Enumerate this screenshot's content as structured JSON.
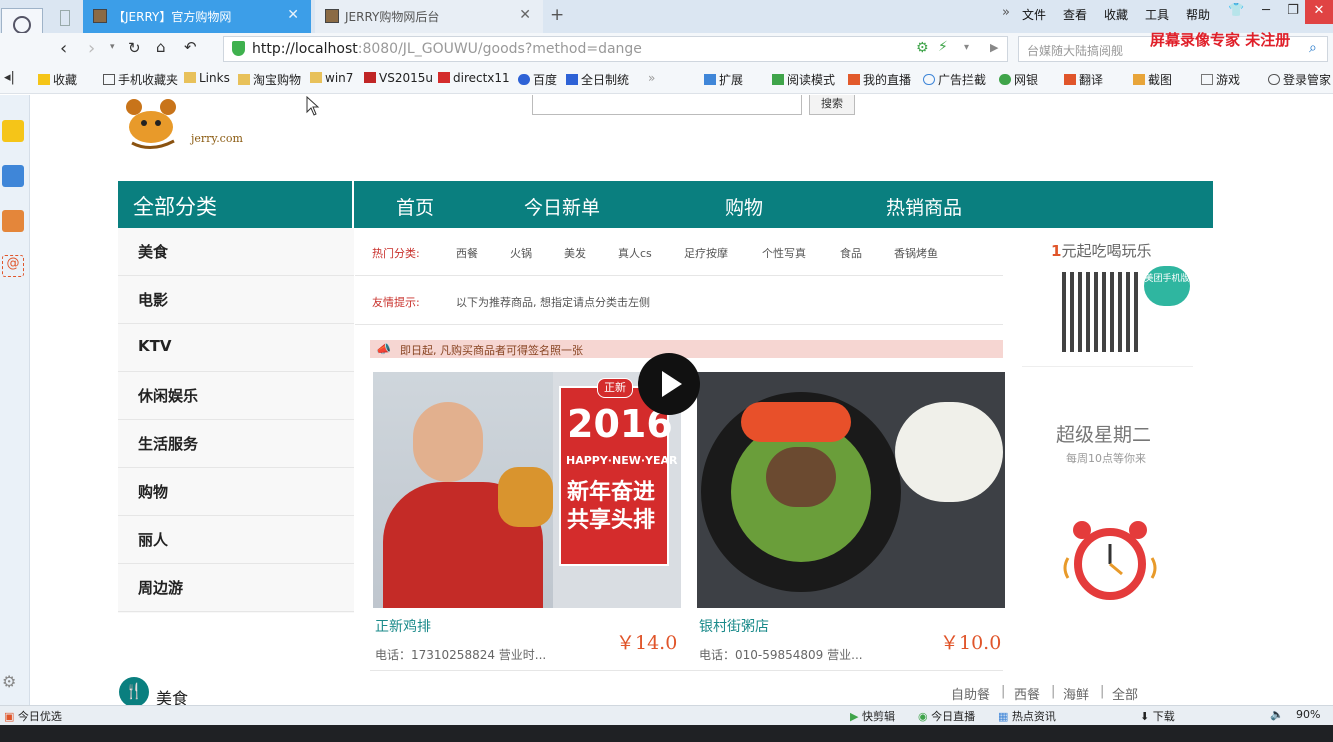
{
  "browser": {
    "tabs": [
      {
        "title": "【JERRY】官方购物网",
        "active": true
      },
      {
        "title": "JERRY购物网后台",
        "active": false
      }
    ],
    "menu": [
      "文件",
      "查看",
      "收藏",
      "工具",
      "帮助"
    ],
    "url_host": "http://localhost",
    "url_rest": ":8080/JL_GOUWU/goods?method=dange",
    "search_placeholder": "台媒随大陆搞阅舰",
    "watermark": "屏幕录像专家  未注册",
    "bookmarks": [
      "收藏",
      "手机收藏夹",
      "Links",
      "淘宝购物",
      "win7",
      "VS2015u",
      "directx11",
      "百度",
      "全日制统"
    ],
    "toolbar_right": [
      "扩展",
      "阅读模式",
      "我的直播",
      "广告拦截",
      "网银",
      "翻译",
      "截图",
      "游戏",
      "登录管家"
    ]
  },
  "site": {
    "logo_text": "jerry.com",
    "search_button": "搜索",
    "all_categories": "全部分类",
    "nav": [
      "首页",
      "今日新单",
      "购物",
      "热销商品"
    ],
    "categories": [
      "美食",
      "电影",
      "KTV",
      "休闲娱乐",
      "生活服务",
      "购物",
      "丽人",
      "周边游"
    ],
    "hot_label": "热门分类:",
    "hot_items": [
      "西餐",
      "火锅",
      "美发",
      "真人cs",
      "足疗按摩",
      "个性写真",
      "食品",
      "香锅烤鱼"
    ],
    "tip_label": "友情提示:",
    "tip_text": "以下为推荐商品, 想指定请点分类击左侧",
    "banner_text": "即日起, 凡购买商品者可得签名照一张",
    "deals": [
      {
        "name": "正新鸡排",
        "price": "￥14.0",
        "phone": "电话：17310258824 营业时...",
        "ad_year": "2016",
        "ad_sub": "HAPPY·NEW·YEAR",
        "ad_line1": "新年奋进",
        "ad_line2": "共享头排",
        "ad_badge": "正新"
      },
      {
        "name": "银村街粥店",
        "price": "￥10.0",
        "phone": "电话：010-59854809 营业..."
      }
    ],
    "promo_prefix": "1",
    "promo_text": "元起吃喝玩乐",
    "qr_badge": "美团手机版",
    "super_title": "超级星期二",
    "super_sub": "每周10点等你来",
    "food_section": "美食",
    "food_tags": [
      "自助餐",
      "|",
      "西餐",
      "|",
      "海鲜",
      "|",
      "全部"
    ]
  },
  "statusbar": {
    "left": "今日优选",
    "items": [
      "快剪辑",
      "今日直播",
      "热点资讯",
      "下载"
    ],
    "zoom": "90%"
  },
  "colors": {
    "teal": "#0a7f7f",
    "active_tab": "#3c9ee8",
    "price": "#e0552a"
  }
}
